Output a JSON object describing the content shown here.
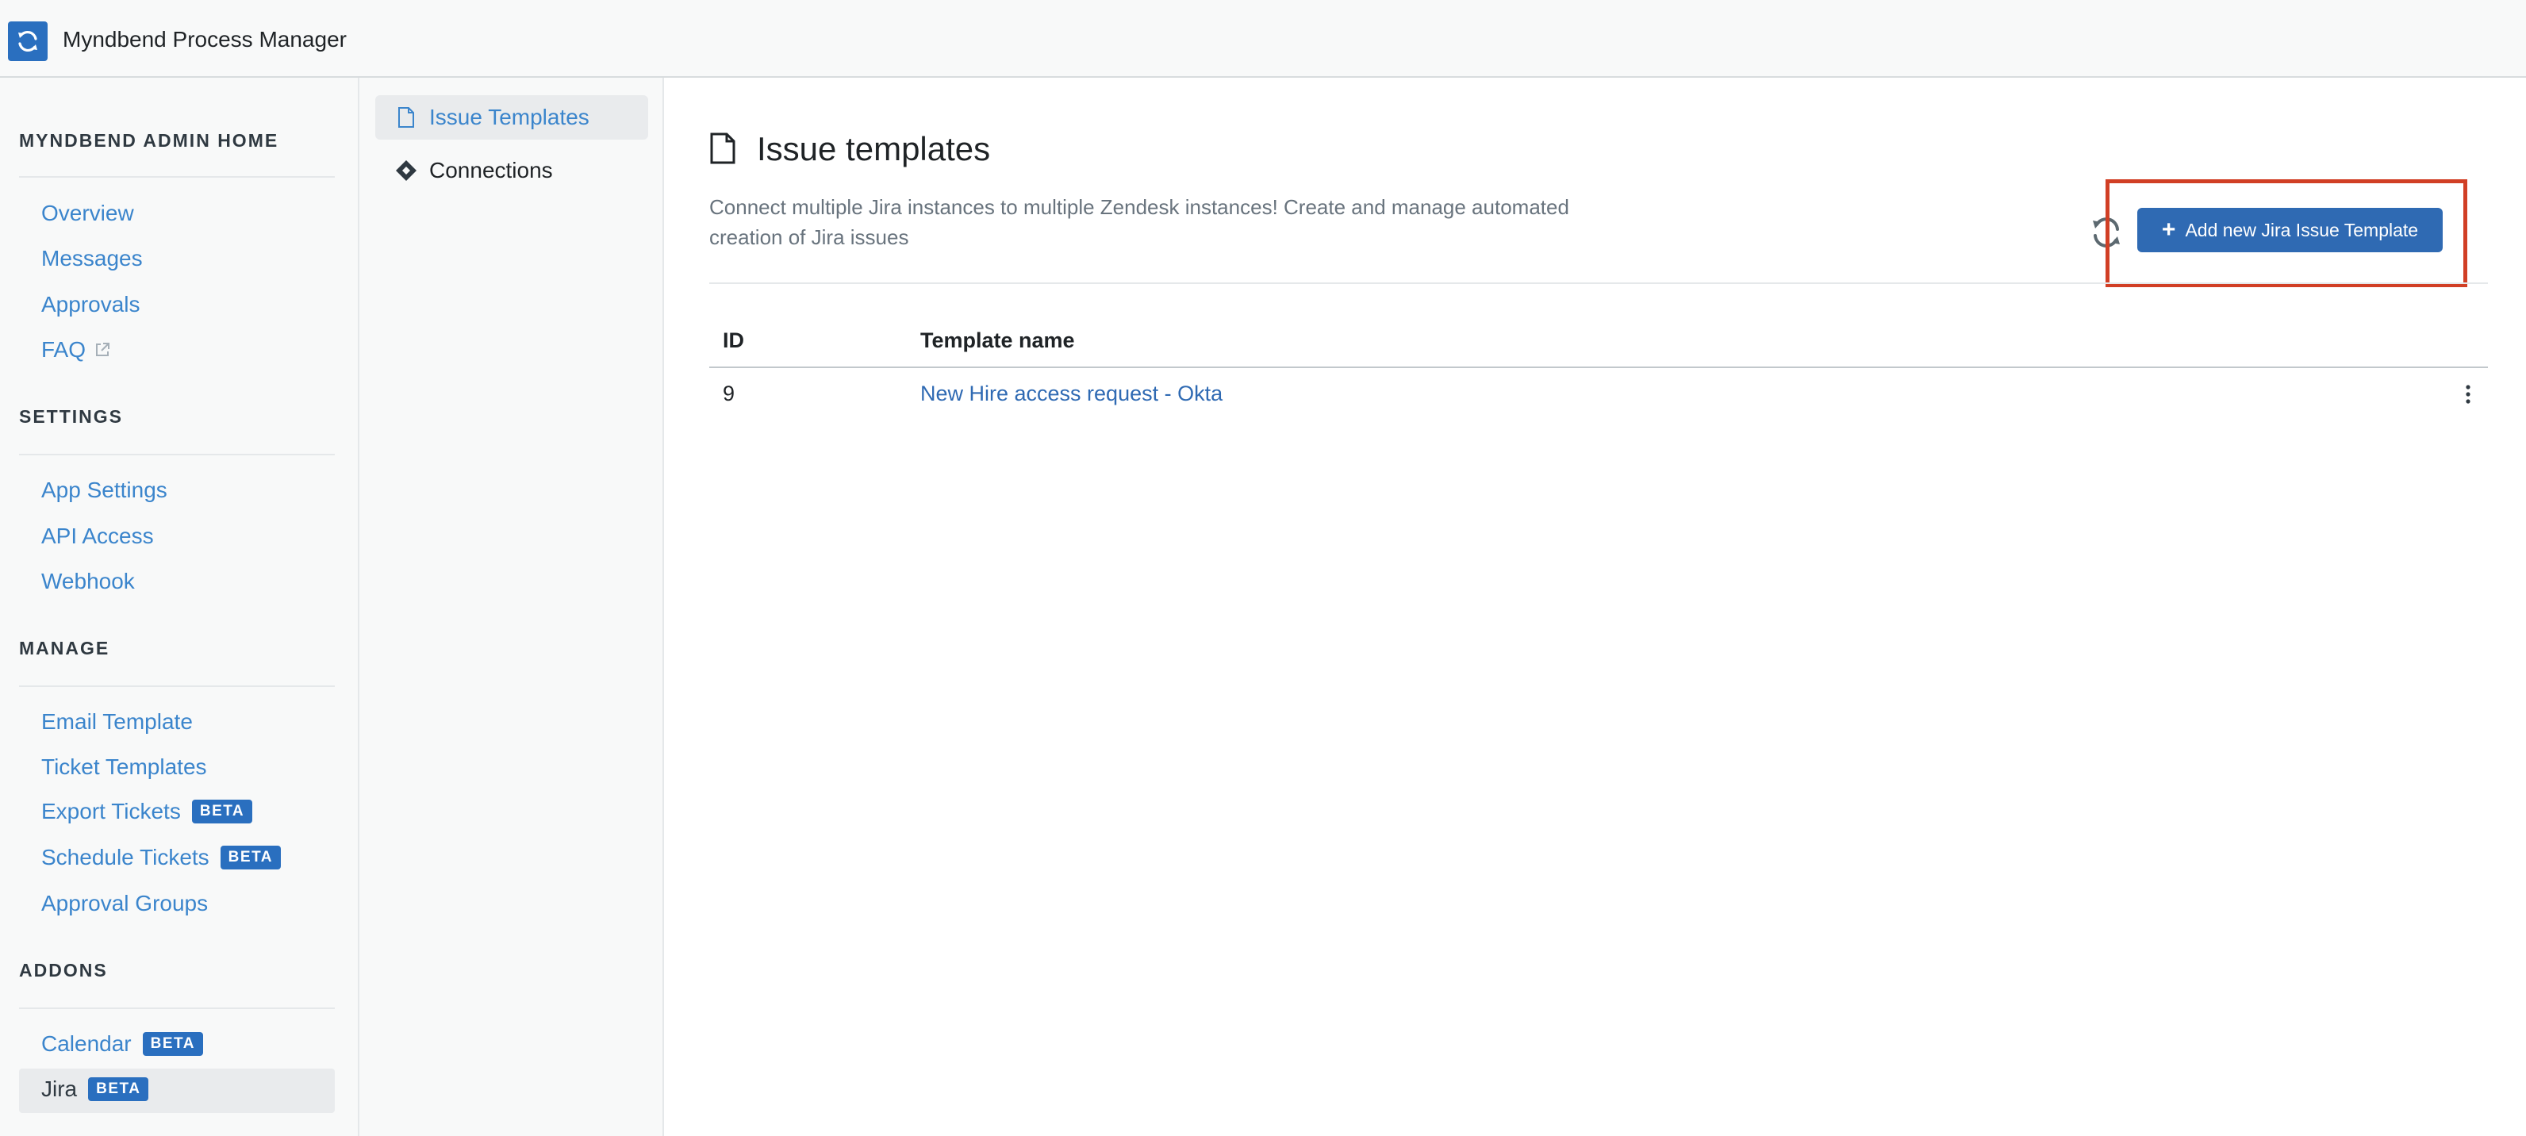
{
  "app": {
    "title": "Myndbend Process Manager",
    "accent_color": "#2a6fbf",
    "logo_icon": "sync-logo-icon"
  },
  "sidebar": {
    "sections": [
      {
        "heading": "MYNDBEND ADMIN HOME",
        "items": [
          {
            "label": "Overview"
          },
          {
            "label": "Messages"
          },
          {
            "label": "Approvals"
          },
          {
            "label": "FAQ",
            "icon": "external-link-icon"
          }
        ]
      },
      {
        "heading": "SETTINGS",
        "items": [
          {
            "label": "App Settings"
          },
          {
            "label": "API Access"
          },
          {
            "label": "Webhook"
          }
        ]
      },
      {
        "heading": "MANAGE",
        "items": [
          {
            "label": "Email Template"
          },
          {
            "label": "Ticket Templates"
          },
          {
            "label": "Export Tickets",
            "badge": "BETA"
          },
          {
            "label": "Schedule Tickets",
            "badge": "BETA"
          },
          {
            "label": "Approval Groups"
          }
        ]
      },
      {
        "heading": "ADDONS",
        "items": [
          {
            "label": "Calendar",
            "badge": "BETA"
          },
          {
            "label": "Jira",
            "badge": "BETA",
            "selected": true
          }
        ]
      }
    ]
  },
  "subnav": {
    "items": [
      {
        "label": "Issue Templates",
        "icon": "document-icon",
        "selected": true
      },
      {
        "label": "Connections",
        "icon": "diamond-icon"
      }
    ]
  },
  "main": {
    "title": "Issue templates",
    "title_icon": "document-icon",
    "description": "Connect multiple Jira instances to multiple Zendesk instances! Create and manage automated creation of Jira issues",
    "refresh_icon": "refresh-icon",
    "add_button_label": "Add new Jira Issue Template",
    "highlight_color": "#d13f25",
    "table": {
      "columns": [
        "ID",
        "Template name"
      ],
      "rows": [
        {
          "id": "9",
          "name": "New Hire access request - Okta"
        }
      ]
    }
  }
}
